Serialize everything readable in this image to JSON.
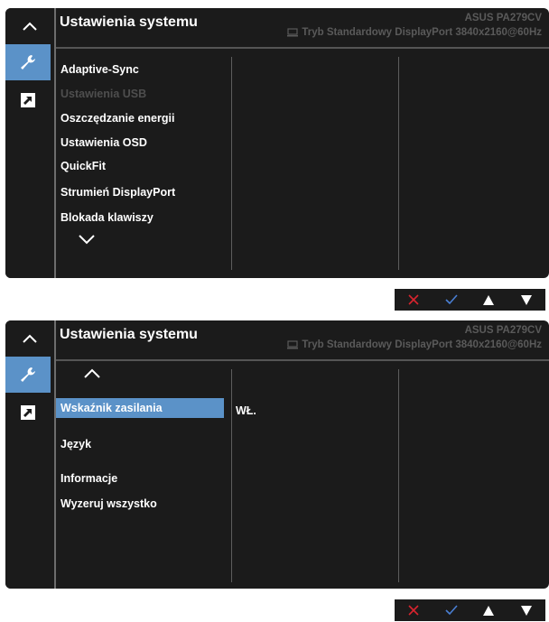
{
  "screens": [
    {
      "title": "Ustawienia systemu",
      "model": "ASUS PA279CV",
      "status": "Tryb Standardowy DisplayPort 3840x2160@60Hz",
      "menu": [
        {
          "label": "Adaptive-Sync",
          "enabled": true
        },
        {
          "label": "Ustawienia USB",
          "enabled": false
        },
        {
          "label": "Oszczędzanie energii",
          "enabled": true
        },
        {
          "label": "Ustawienia OSD",
          "enabled": true
        },
        {
          "label": "QuickFit",
          "enabled": true
        },
        {
          "label": "Strumień DisplayPort",
          "enabled": true
        },
        {
          "label": "Blokada klawiszy",
          "enabled": true
        }
      ]
    },
    {
      "title": "Ustawienia systemu",
      "model": "ASUS PA279CV",
      "status": "Tryb Standardowy DisplayPort 3840x2160@60Hz",
      "selected": "Wskaźnik zasilania",
      "selected_value": "WŁ.",
      "menu": [
        {
          "label": "Język",
          "enabled": true
        },
        {
          "label": "Informacje",
          "enabled": true
        },
        {
          "label": "Wyzeruj wszystko",
          "enabled": true
        }
      ]
    }
  ],
  "icons": {
    "up": "chevron-up-icon",
    "down": "chevron-down-icon",
    "tool": "wrench-icon",
    "shortcut": "shortcut-arrow-icon",
    "monitor": "monitor-icon"
  },
  "keys": [
    "close",
    "confirm",
    "up",
    "down"
  ],
  "colors": {
    "panel": "#1b1b1b",
    "accent": "#5b92c8",
    "close_red": "#d9242e",
    "confirm_blue": "#4a7fd4",
    "dim_text": "#4e4e4e"
  }
}
